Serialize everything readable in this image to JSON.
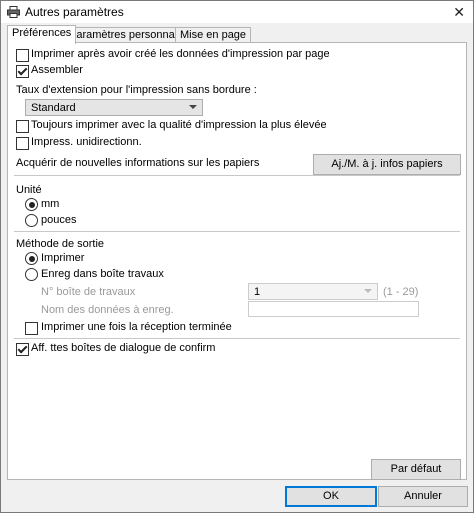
{
  "window": {
    "title": "Autres paramètres",
    "close_glyph": "✕"
  },
  "tabs": [
    {
      "label": "Préférences"
    },
    {
      "label": "Paramètres personnalisés"
    },
    {
      "label": "Mise en page"
    }
  ],
  "preferences": {
    "print_after_create": {
      "label": "Imprimer après avoir créé les données d'impression par page",
      "checked": false
    },
    "collate": {
      "label": "Assembler",
      "checked": true
    },
    "expansion_label": "Taux d'extension pour l'impression sans bordure :",
    "expansion_value": "Standard",
    "always_highest_quality": {
      "label": "Toujours imprimer avec la qualité d'impression la plus élevée",
      "checked": false
    },
    "unidirectional": {
      "label": "Impress. unidirectionn.",
      "checked": false
    },
    "paper_info_label": "Acquérir de nouvelles informations sur les papiers",
    "paper_info_button": "Aj./M. à j. infos papiers",
    "unit_label": "Unité",
    "unit_mm": "mm",
    "unit_inches": "pouces",
    "unit_selected": "mm",
    "output_label": "Méthode de sortie",
    "output_print": "Imprimer",
    "output_store": "Enreg dans boîte travaux",
    "output_selected": "print",
    "box_number_label": "N° boîte de travaux",
    "box_number_value": "1",
    "box_number_range": "(1 - 29)",
    "data_name_label": "Nom des données à enreg.",
    "data_name_value": "",
    "print_on_receive": {
      "label": "Imprimer une fois la réception terminée",
      "checked": false
    },
    "show_confirm_dialogs": {
      "label": "Aff. ttes boîtes de dialogue de confirm",
      "checked": true
    },
    "default_button": "Par défaut"
  },
  "footer": {
    "ok": "OK",
    "cancel": "Annuler"
  }
}
